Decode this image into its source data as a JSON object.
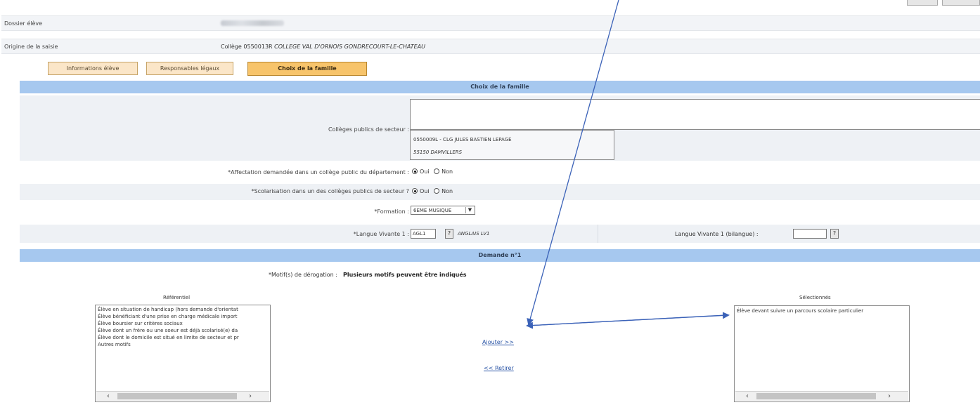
{
  "header": {
    "dossier_label": "Dossier élève",
    "origine_label": "Origine de la saisie",
    "origine_type": "Collège",
    "origine_code": "0550013R",
    "origine_name": "COLLEGE VAL D'ORNOIS GONDRECOURT-LE-CHATEAU"
  },
  "tabs": [
    {
      "label": "Informations élève",
      "active": false
    },
    {
      "label": "Responsables légaux",
      "active": false
    },
    {
      "label": "Choix de la famille",
      "active": true
    }
  ],
  "choix": {
    "section_title": "Choix de la famille",
    "colleges_label": "Collèges publics de secteur :",
    "college_line1": "0550009L - CLG JULES BASTIEN LEPAGE",
    "college_line2": "55150 DAMVILLERS",
    "affectation_label": "*Affectation demandée dans un collège public du département :",
    "affectation_value": "Oui",
    "scolarisation_label": "*Scolarisation dans un des collèges publics de secteur ?",
    "scolarisation_value": "Oui",
    "oui_label": "Oui",
    "non_label": "Non",
    "formation_label": "*Formation :",
    "formation_value": "6EME MUSIQUE",
    "lv1_label": "*Langue Vivante 1 :",
    "lv1_code": "AGL1",
    "lv1_name": "ANGLAIS LV1",
    "lv1_bilangue_label": "Langue Vivante 1 (bilangue) :",
    "lv1_bilangue_value": "",
    "help_label": "?"
  },
  "demande": {
    "section_title": "Demande n°1",
    "motif_label": "*Motif(s) de dérogation :",
    "motif_hint": "Plusieurs motifs peuvent être indiqués",
    "referentiel_label": "Référentiel",
    "selectionnes_label": "Sélectionnés",
    "referentiel_items": [
      "Élève en situation de handicap (hors demande d'orientat",
      "Élève bénéficiant d'une prise en charge médicale import",
      "Élève boursier sur critères sociaux",
      "Élève dont un frère ou une soeur est déjà scolarisé(e) da",
      "Élève dont le domicile est situé en limite de secteur et pr",
      "Autres motifs"
    ],
    "selectionnes_items": [
      "Élève devant suivre un parcours scolaire particulier"
    ],
    "ajouter_label": "Ajouter >>",
    "retirer_label": "<< Retirer"
  },
  "scroll": {
    "left_arrow": "‹",
    "right_arrow": "›"
  },
  "colors": {
    "section_blue": "#a6c8ef",
    "tab_active": "#f7c46b",
    "tab_inactive": "#fbe6c8",
    "annotation_arrow": "#3b62b8"
  }
}
